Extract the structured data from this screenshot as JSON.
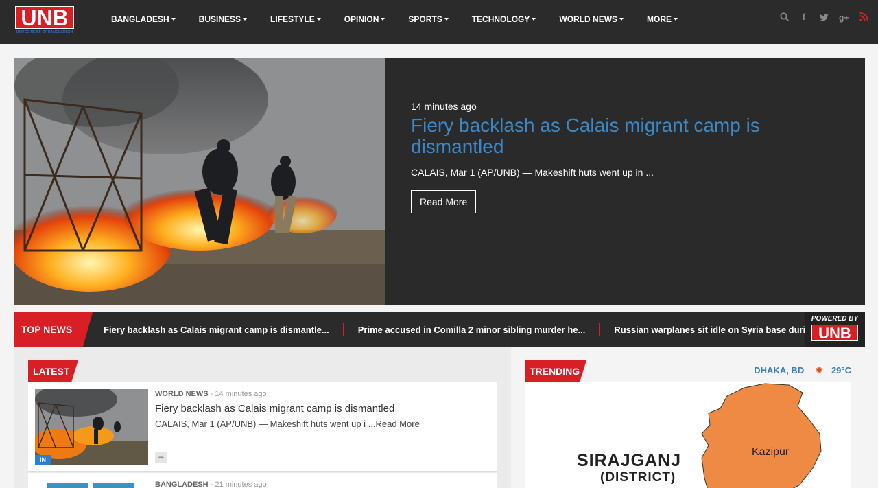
{
  "brand": {
    "logo_text": "UNB",
    "logo_subtext": "UNITED NEWS OF BANGLADESH"
  },
  "nav": {
    "items": [
      {
        "label": "BANGLADESH"
      },
      {
        "label": "BUSINESS"
      },
      {
        "label": "LIFESTYLE"
      },
      {
        "label": "OPINION"
      },
      {
        "label": "SPORTS"
      },
      {
        "label": "TECHNOLOGY"
      },
      {
        "label": "WORLD NEWS"
      },
      {
        "label": "MORE"
      }
    ],
    "icons": [
      "search-icon",
      "facebook-icon",
      "twitter-icon",
      "google-plus-icon",
      "rss-icon"
    ]
  },
  "hero": {
    "time": "14 minutes ago",
    "title": "Fiery backlash as Calais migrant camp is dismantled",
    "excerpt": "CALAIS, Mar 1 (AP/UNB) — Makeshift huts went up in ...",
    "read_more": "Read More"
  },
  "ticker": {
    "label": "TOP NEWS",
    "items": [
      "Fiery backlash as Calais migrant camp is dismantle...",
      "Prime accused in Comilla 2 minor sibling murder he...",
      "Russian warplanes sit idle on Syria base during ce..."
    ],
    "powered_by": "POWERED BY",
    "powered_logo": "UNB"
  },
  "latest": {
    "label": "LATEST",
    "articles": [
      {
        "category": "WORLD NEWS",
        "time": " - 14 minutes ago",
        "title": "Fiery backlash as Calais migrant camp is dismantled",
        "excerpt": "CALAIS, Mar 1 (AP/UNB) — Makeshift huts went up i ...Read More",
        "badge": "IN"
      },
      {
        "category": "BANGLADESH",
        "time": " - 21 minutes ago"
      }
    ]
  },
  "trending": {
    "label": "TRENDING",
    "weather_location": "DHAKA, BD",
    "weather_temp": "29°C",
    "map_title": "SIRAJGANJ",
    "map_subtitle": "(DISTRICT)",
    "map_place": "Kazipur"
  },
  "colors": {
    "accent": "#d71f25",
    "link": "#3a88c8",
    "dark": "#2b2b2b"
  }
}
